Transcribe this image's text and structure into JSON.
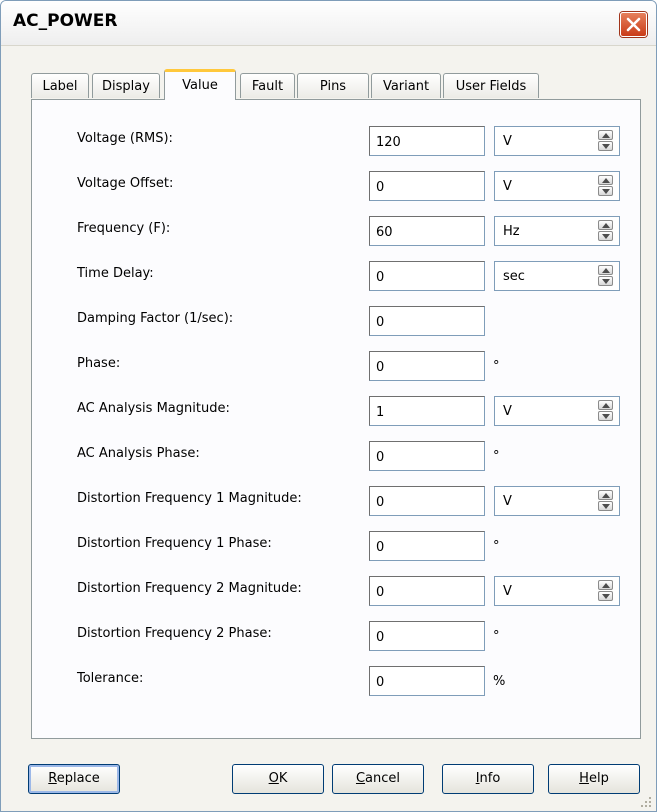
{
  "window": {
    "title": "AC_POWER"
  },
  "tabs": [
    {
      "label": "Label"
    },
    {
      "label": "Display"
    },
    {
      "label": "Value"
    },
    {
      "label": "Fault"
    },
    {
      "label": "Pins"
    },
    {
      "label": "Variant"
    },
    {
      "label": "User Fields"
    }
  ],
  "active_tab": "Value",
  "params": [
    {
      "label": "Voltage (RMS):",
      "value": "120",
      "unit": "V",
      "control": "spinner"
    },
    {
      "label": "Voltage Offset:",
      "value": "0",
      "unit": "V",
      "control": "spinner"
    },
    {
      "label": "Frequency (F):",
      "value": "60",
      "unit": "Hz",
      "control": "spinner"
    },
    {
      "label": "Time Delay:",
      "value": "0",
      "unit": "sec",
      "control": "spinner"
    },
    {
      "label": "Damping Factor (1/sec):",
      "value": "0",
      "unit": "",
      "control": "none"
    },
    {
      "label": "Phase:",
      "value": "0",
      "unit": "°",
      "control": "suffix"
    },
    {
      "label": "AC Analysis Magnitude:",
      "value": "1",
      "unit": "V",
      "control": "spinner"
    },
    {
      "label": "AC Analysis Phase:",
      "value": "0",
      "unit": "°",
      "control": "suffix"
    },
    {
      "label": "Distortion Frequency 1 Magnitude:",
      "value": "0",
      "unit": "V",
      "control": "spinner"
    },
    {
      "label": "Distortion Frequency 1 Phase:",
      "value": "0",
      "unit": "°",
      "control": "suffix"
    },
    {
      "label": "Distortion Frequency 2 Magnitude:",
      "value": "0",
      "unit": "V",
      "control": "spinner"
    },
    {
      "label": "Distortion Frequency 2 Phase:",
      "value": "0",
      "unit": "°",
      "control": "suffix"
    },
    {
      "label": "Tolerance:",
      "value": "0",
      "unit": "%",
      "control": "suffix"
    }
  ],
  "buttons": {
    "replace": {
      "label": "Replace",
      "mnemonic": "R"
    },
    "ok": {
      "label": "OK",
      "mnemonic": "O"
    },
    "cancel": {
      "label": "Cancel",
      "mnemonic": "C"
    },
    "info": {
      "label": "Info",
      "mnemonic": "I"
    },
    "help": {
      "label": "Help",
      "mnemonic": "H"
    }
  },
  "colors": {
    "active_tab_accent": "#ffc83c",
    "close_button": "#c93b18",
    "panel_bg": "#fcfcfe"
  }
}
